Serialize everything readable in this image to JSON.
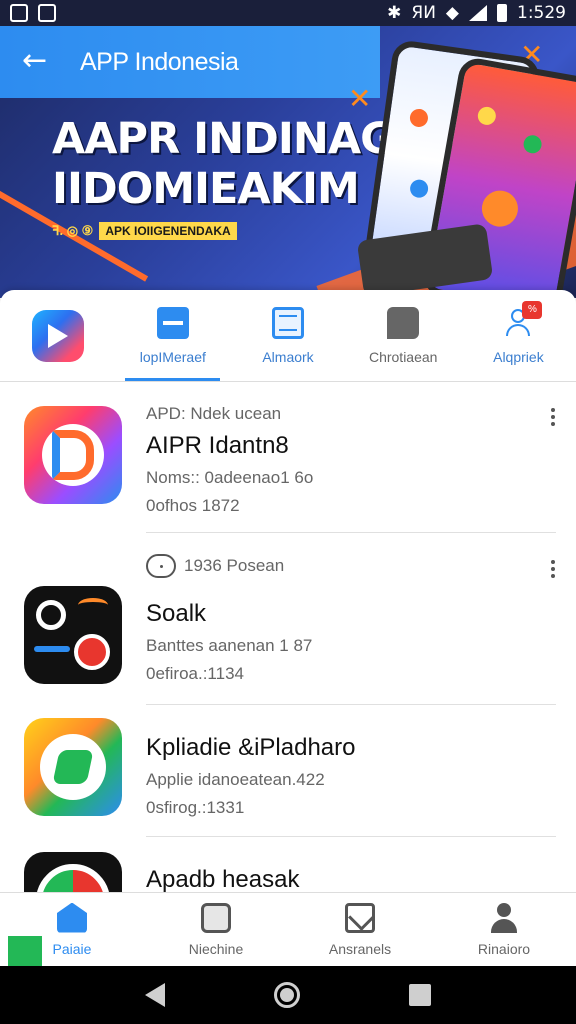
{
  "status_bar": {
    "time": "1:529",
    "left_icons": [
      "app-notification-icon",
      "app-notification-icon"
    ],
    "right_icons": [
      "bluetooth-icon",
      "signal-text",
      "wifi-icon",
      "cell-signal-icon",
      "battery-icon"
    ],
    "signal_text": "ЯИ"
  },
  "header": {
    "back_icon": "back-arrow-icon",
    "title": "APP Indonesia"
  },
  "banner": {
    "headline_line1": "AAPR INDINAGA",
    "headline_line2": "IIDOMIEAKIM",
    "tagline_prefix": "ꟻ. ◎ ⑨",
    "tagline_pill": "APK IOIIGENENDAKA"
  },
  "categories": [
    {
      "label": "",
      "icon": "app-logo-icon",
      "active": false
    },
    {
      "label": "lopIMeraef",
      "icon": "briefcase-icon",
      "active": true
    },
    {
      "label": "Almaork",
      "icon": "document-icon",
      "active": false
    },
    {
      "label": "Chrotiaean",
      "icon": "chat-icon",
      "active": false
    },
    {
      "label": "Alqpriek",
      "icon": "person-badge-icon",
      "active": false,
      "badge": "%"
    }
  ],
  "apps": [
    {
      "kicker": "APD: Ndek ucean",
      "name": "AIPR Idantn8",
      "line1": "Noms:: 0adeenao1 6o",
      "line2": "0ofhos 1872",
      "has_menu": true,
      "kicker_icon": ""
    },
    {
      "kicker": "1936 Posean",
      "name": "Soalk",
      "line1": "Banttes aanenan 1 87",
      "line2": "0efiroa.:1134",
      "has_menu": true,
      "kicker_icon": "chat-bubble-icon"
    },
    {
      "kicker": "",
      "name": "Kpliadie &iPladharo",
      "line1": "Applie idanoeatean.422",
      "line2": "0sfirog.:1331",
      "has_menu": false,
      "kicker_icon": ""
    },
    {
      "kicker": "",
      "name": "Apadb heasak",
      "line1": "",
      "line2": "",
      "has_menu": false,
      "kicker_icon": ""
    }
  ],
  "bottom_nav": [
    {
      "label": "Paiaie",
      "icon": "home-icon",
      "active": true
    },
    {
      "label": "Niechine",
      "icon": "device-icon",
      "active": false
    },
    {
      "label": "Ansranels",
      "icon": "mail-icon",
      "active": false
    },
    {
      "label": "Rinaioro",
      "icon": "user-icon",
      "active": false
    }
  ],
  "system_nav": {
    "back": "back-triangle-icon",
    "home": "home-circle-icon",
    "recent": "recent-square-icon"
  },
  "colors": {
    "accent": "#2d8cf0",
    "banner_dark": "#1d2a63",
    "orange": "#ff6b2c",
    "yellow": "#ffd84a"
  }
}
